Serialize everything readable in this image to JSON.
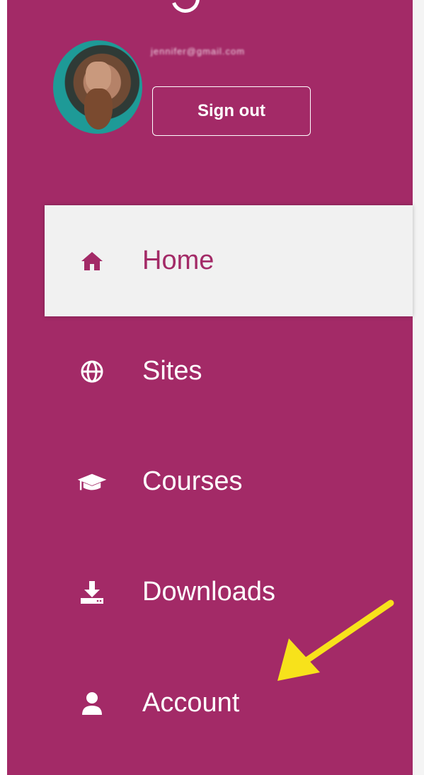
{
  "user": {
    "email": "jennifer@gmail.com",
    "signout_label": "Sign out"
  },
  "nav": {
    "items": [
      {
        "label": "Home",
        "icon": "home-icon",
        "active": true
      },
      {
        "label": "Sites",
        "icon": "globe-icon",
        "active": false
      },
      {
        "label": "Courses",
        "icon": "graduation-cap-icon",
        "active": false
      },
      {
        "label": "Downloads",
        "icon": "download-icon",
        "active": false
      },
      {
        "label": "Account",
        "icon": "user-icon",
        "active": false
      }
    ]
  },
  "colors": {
    "sidebar_bg": "#a32a67",
    "active_bg": "#f1f1f1",
    "active_text": "#a32a67",
    "text": "#ffffff",
    "annotation_arrow": "#f7e21b"
  }
}
